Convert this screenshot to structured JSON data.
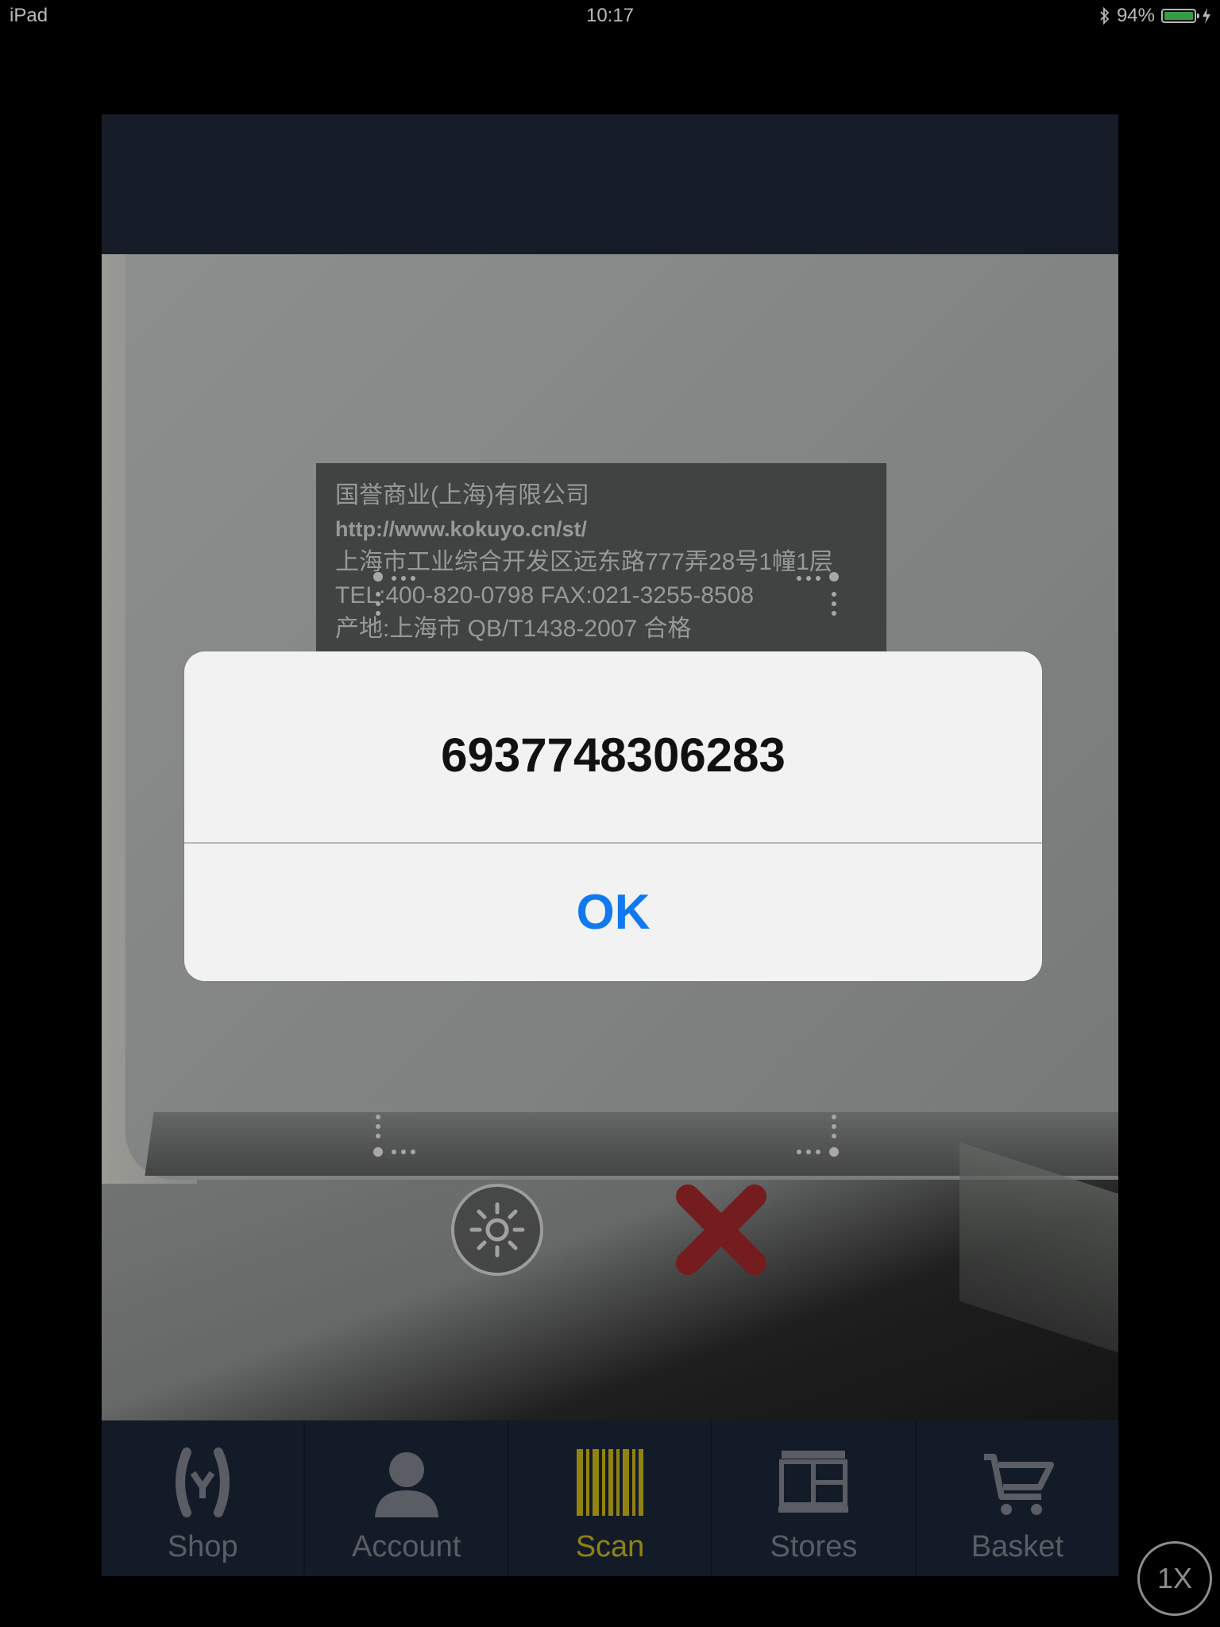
{
  "status_bar": {
    "device": "iPad",
    "time": "10:17",
    "battery": "94%",
    "battery_level": 0.94
  },
  "camera": {
    "label_lines": [
      "国誉商业(上海)有限公司",
      "http://www.kokuyo.cn/st/",
      "上海市工业综合开发区远东路777弄28号1幢1层",
      "TEL:400-820-0798   FAX:021-3255-8508",
      "产地:上海市        QB/T1438-2007 合格"
    ]
  },
  "controls": {
    "flash_icon": "flash-icon",
    "close_icon": "close-icon"
  },
  "alert": {
    "message": "6937748306283",
    "ok_label": "OK"
  },
  "tabs": [
    {
      "label": "Shop",
      "icon": "shop-icon",
      "active": false
    },
    {
      "label": "Account",
      "icon": "account-icon",
      "active": false
    },
    {
      "label": "Scan",
      "icon": "barcode-icon",
      "active": true
    },
    {
      "label": "Stores",
      "icon": "stores-icon",
      "active": false
    },
    {
      "label": "Basket",
      "icon": "basket-icon",
      "active": false
    }
  ],
  "zoom_indicator": "1X",
  "colors": {
    "active_tab": "#c8b619",
    "ok_blue": "#1179f0",
    "navbar": "#1f2838",
    "close_red": "#a2272c"
  }
}
